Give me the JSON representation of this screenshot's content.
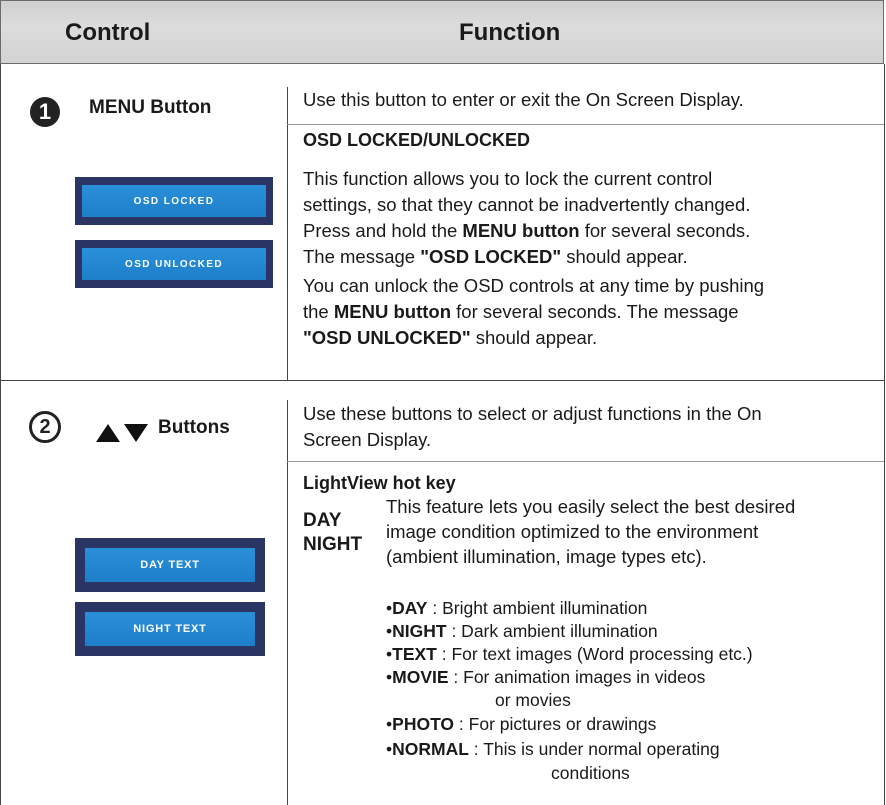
{
  "header": {
    "control": "Control",
    "function": "Function"
  },
  "section1": {
    "number": "1",
    "control_label": "MENU Button",
    "intro": "Use this button to enter or exit the On Screen Display.",
    "subheading": "OSD LOCKED/UNLOCKED",
    "para1": {
      "l1": "This function allows you to lock the current control",
      "l2": "settings, so that they cannot be inadvertently changed.",
      "l3_pre": "Press and hold the ",
      "l3_bold": "MENU button",
      "l3_post": " for several seconds.",
      "l4_pre": "The message ",
      "l4_bold": "\"OSD LOCKED\"",
      "l4_post": " should appear."
    },
    "para2": {
      "l1": "You can unlock the OSD controls at any time by pushing",
      "l2_pre": "the ",
      "l2_bold": "MENU button",
      "l2_post": " for several seconds. The message",
      "l3_bold": "\"OSD UNLOCKED\"",
      "l3_post": " should appear."
    },
    "osd_locked": "OSD LOCKED",
    "osd_unlocked": "OSD UNLOCKED"
  },
  "section2": {
    "number": "2",
    "control_label": "Buttons",
    "intro_l1": "Use these buttons to select or adjust functions in the On",
    "intro_l2": "Screen Display.",
    "subheading": "LightView hot key",
    "mode_day": "DAY",
    "mode_night": "NIGHT",
    "desc_l1": "This feature lets you easily select the best desired",
    "desc_l2": "image condition optimized to the environment",
    "desc_l3": "(ambient illumination, image types etc).",
    "osd_day": "DAY TEXT",
    "osd_night": "NIGHT TEXT",
    "bullets": [
      {
        "term": "DAY",
        "desc": " : Bright ambient illumination"
      },
      {
        "term": "NIGHT",
        "desc": " : Dark ambient illumination"
      },
      {
        "term": "TEXT",
        "desc": " : For text images (Word processing etc.)"
      },
      {
        "term": "MOVIE",
        "desc": " : For animation images in videos"
      },
      {
        "term": "",
        "desc": "or movies"
      },
      {
        "term": "PHOTO",
        "desc": " : For pictures or drawings"
      },
      {
        "term": "NORMAL",
        "desc": " : This is under normal operating"
      },
      {
        "term": "",
        "desc": "conditions"
      }
    ],
    "bullet_mark": "•"
  }
}
